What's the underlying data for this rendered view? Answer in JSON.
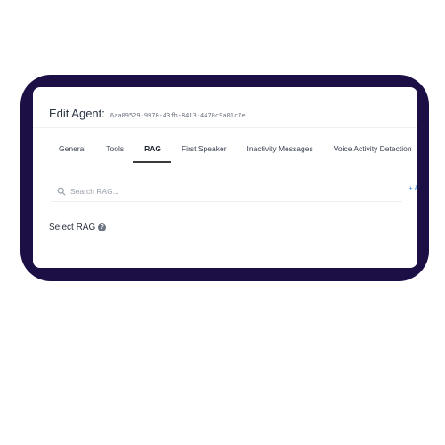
{
  "header": {
    "title": "Edit Agent:",
    "agent_id": "6aa09529-9970-43fb-8413-4470c9a01c7e"
  },
  "tabs": [
    {
      "label": "General",
      "active": false
    },
    {
      "label": "Tools",
      "active": false
    },
    {
      "label": "RAG",
      "active": true
    },
    {
      "label": "First Speaker",
      "active": false
    },
    {
      "label": "Inactivity Messages",
      "active": false
    },
    {
      "label": "Voice Activity Detection",
      "active": false
    }
  ],
  "search": {
    "placeholder": "Search RAG...",
    "icon": "search-icon"
  },
  "add_link": {
    "label": "+ A"
  },
  "rag": {
    "select_label": "Select RAG",
    "help_icon": "help-icon",
    "help_glyph": "?"
  },
  "colors": {
    "frame": "#1c0f45",
    "screen": "#ffffff",
    "accent_link": "#4b8fe0",
    "active_tab_underline": "#3b3b3b"
  }
}
